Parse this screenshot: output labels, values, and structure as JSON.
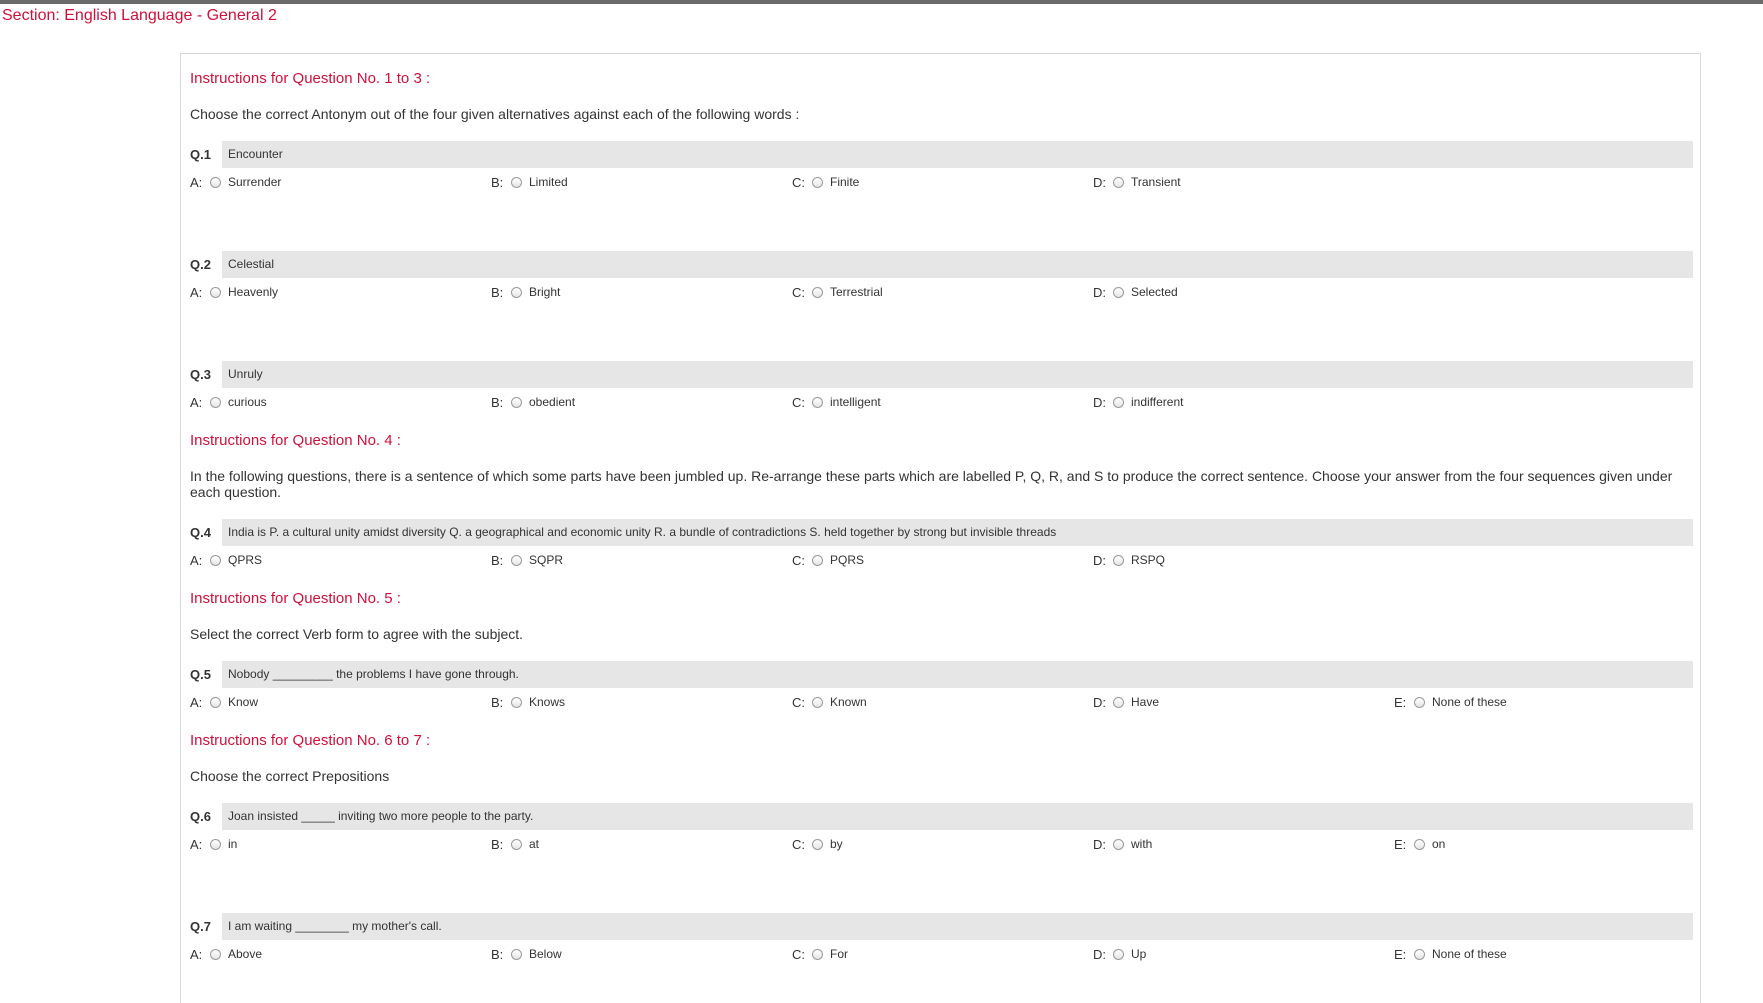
{
  "section": "Section: English Language - General 2",
  "groups": [
    {
      "instruction_title": "Instructions for Question No. 1 to 3 :",
      "instruction_text": "Choose the correct Antonym out of the four given alternatives against each of the following words :",
      "questions": [
        {
          "no": "Q.1",
          "text": "Encounter",
          "options": [
            {
              "letter": "A:",
              "label": "Surrender"
            },
            {
              "letter": "B:",
              "label": "Limited"
            },
            {
              "letter": "C:",
              "label": "Finite"
            },
            {
              "letter": "D:",
              "label": "Transient"
            }
          ]
        },
        {
          "no": "Q.2",
          "text": "Celestial",
          "options": [
            {
              "letter": "A:",
              "label": "Heavenly"
            },
            {
              "letter": "B:",
              "label": "Bright"
            },
            {
              "letter": "C:",
              "label": "Terrestrial"
            },
            {
              "letter": "D:",
              "label": "Selected"
            }
          ]
        },
        {
          "no": "Q.3",
          "text": "Unruly",
          "options": [
            {
              "letter": "A:",
              "label": "curious"
            },
            {
              "letter": "B:",
              "label": "obedient"
            },
            {
              "letter": "C:",
              "label": "intelligent"
            },
            {
              "letter": "D:",
              "label": "indifferent"
            }
          ]
        }
      ]
    },
    {
      "instruction_title": "Instructions for Question No. 4 :",
      "instruction_text": "In the following questions, there is a sentence of which some parts have been jumbled up. Re-arrange these parts which are labelled P, Q, R, and S to produce the correct sentence. Choose your answer from the four sequences given under each question.",
      "questions": [
        {
          "no": "Q.4",
          "text": "India is P. a cultural unity amidst diversity Q. a geographical and economic unity R. a bundle of contradictions S. held together by strong but invisible threads",
          "options": [
            {
              "letter": "A:",
              "label": "QPRS"
            },
            {
              "letter": "B:",
              "label": "SQPR"
            },
            {
              "letter": "C:",
              "label": "PQRS"
            },
            {
              "letter": "D:",
              "label": "RSPQ"
            }
          ]
        }
      ]
    },
    {
      "instruction_title": "Instructions for Question No. 5 :",
      "instruction_text": "Select the correct Verb form to agree with the subject.",
      "questions": [
        {
          "no": "Q.5",
          "text": "Nobody _________ the problems I have gone through.",
          "options": [
            {
              "letter": "A:",
              "label": "Know"
            },
            {
              "letter": "B:",
              "label": "Knows"
            },
            {
              "letter": "C:",
              "label": "Known"
            },
            {
              "letter": "D:",
              "label": "Have"
            },
            {
              "letter": "E:",
              "label": "None of these"
            }
          ]
        }
      ]
    },
    {
      "instruction_title": "Instructions for Question No. 6 to 7 :",
      "instruction_text": "Choose the correct Prepositions",
      "questions": [
        {
          "no": "Q.6",
          "text": "Joan insisted _____ inviting two more people to the party.",
          "options": [
            {
              "letter": "A:",
              "label": "in"
            },
            {
              "letter": "B:",
              "label": "at"
            },
            {
              "letter": "C:",
              "label": "by"
            },
            {
              "letter": "D:",
              "label": "with"
            },
            {
              "letter": "E:",
              "label": "on"
            }
          ]
        },
        {
          "no": "Q.7",
          "text": "I am waiting ________ my mother's call.",
          "options": [
            {
              "letter": "A:",
              "label": "Above"
            },
            {
              "letter": "B:",
              "label": "Below"
            },
            {
              "letter": "C:",
              "label": "For"
            },
            {
              "letter": "D:",
              "label": "Up"
            },
            {
              "letter": "E:",
              "label": "None of these"
            }
          ]
        }
      ]
    }
  ]
}
